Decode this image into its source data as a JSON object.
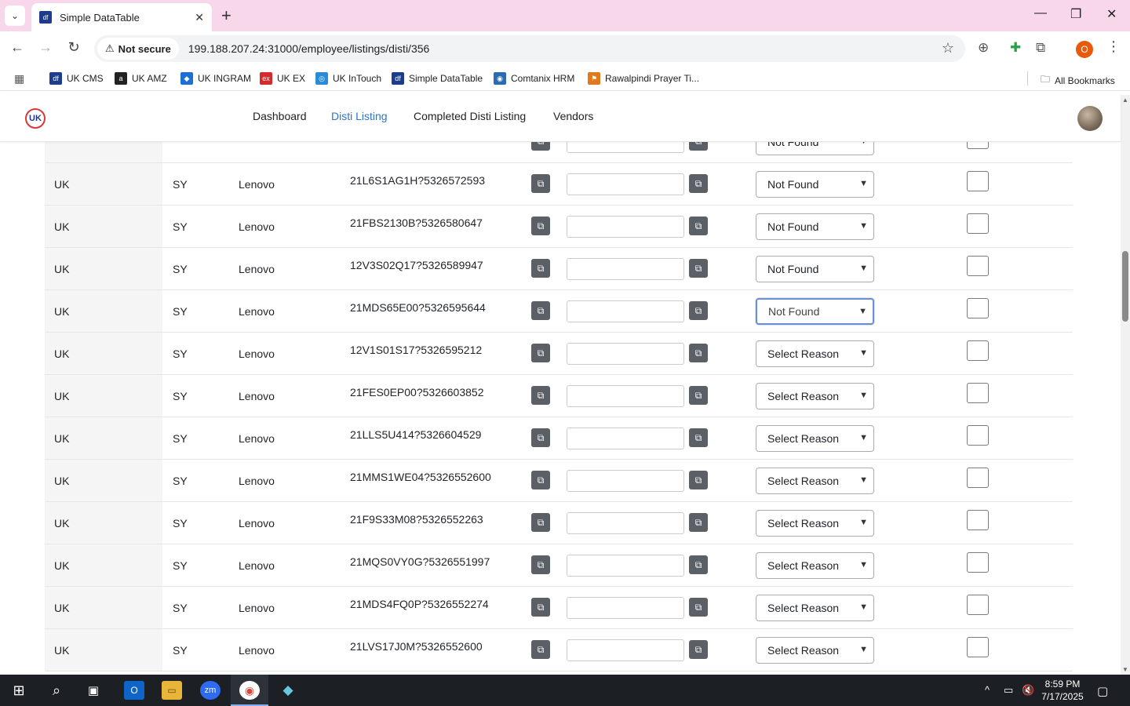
{
  "browser": {
    "tab_title": "Simple DataTable",
    "tab_favicon": "df",
    "security_label": "Not secure",
    "url": "199.188.207.24:31000/employee/listings/disti/356",
    "profile_initial": "O",
    "bookmarks": [
      {
        "label": "UK CMS",
        "icon": "df",
        "color": "#1e3c8c"
      },
      {
        "label": "UK AMZ",
        "icon": "a",
        "color": "#222222"
      },
      {
        "label": "UK INGRAM",
        "icon": "◆",
        "color": "#1d6fd1"
      },
      {
        "label": "UK EX",
        "icon": "ex",
        "color": "#d62b2b"
      },
      {
        "label": "UK InTouch",
        "icon": "◎",
        "color": "#2a8bd6"
      },
      {
        "label": "Simple DataTable",
        "icon": "df",
        "color": "#1e3c8c"
      },
      {
        "label": "Comtanix HRM",
        "icon": "◉",
        "color": "#2a6cb3"
      },
      {
        "label": "Rawalpindi Prayer Ti...",
        "icon": "⚑",
        "color": "#e07a1f"
      }
    ],
    "all_bookmarks": "All Bookmarks"
  },
  "app": {
    "logo_text": "UK",
    "nav": [
      "Dashboard",
      "Disti Listing",
      "Completed Disti Listing",
      "Vendors"
    ],
    "active_nav": "Disti Listing",
    "accent_color": "#2c76c9"
  },
  "table": {
    "partial_top_row": {
      "reason": "Not Found"
    },
    "rows": [
      {
        "country": "UK",
        "code": "SY",
        "brand": "Lenovo",
        "sku": "21L6S1AG1H?5326572593",
        "input": "",
        "reason": "Not Found",
        "focused": false
      },
      {
        "country": "UK",
        "code": "SY",
        "brand": "Lenovo",
        "sku": "21FBS2130B?5326580647",
        "input": "",
        "reason": "Not Found",
        "focused": false
      },
      {
        "country": "UK",
        "code": "SY",
        "brand": "Lenovo",
        "sku": "12V3S02Q17?5326589947",
        "input": "",
        "reason": "Not Found",
        "focused": false
      },
      {
        "country": "UK",
        "code": "SY",
        "brand": "Lenovo",
        "sku": "21MDS65E00?5326595644",
        "input": "",
        "reason": "Not Found",
        "focused": true
      },
      {
        "country": "UK",
        "code": "SY",
        "brand": "Lenovo",
        "sku": "12V1S01S17?5326595212",
        "input": "",
        "reason": "Select Reason",
        "focused": false
      },
      {
        "country": "UK",
        "code": "SY",
        "brand": "Lenovo",
        "sku": "21FES0EP00?5326603852",
        "input": "",
        "reason": "Select Reason",
        "focused": false
      },
      {
        "country": "UK",
        "code": "SY",
        "brand": "Lenovo",
        "sku": "21LLS5U414?5326604529",
        "input": "",
        "reason": "Select Reason",
        "focused": false
      },
      {
        "country": "UK",
        "code": "SY",
        "brand": "Lenovo",
        "sku": "21MMS1WE04?5326552600",
        "input": "",
        "reason": "Select Reason",
        "focused": false
      },
      {
        "country": "UK",
        "code": "SY",
        "brand": "Lenovo",
        "sku": "21F9S33M08?5326552263",
        "input": "",
        "reason": "Select Reason",
        "focused": false
      },
      {
        "country": "UK",
        "code": "SY",
        "brand": "Lenovo",
        "sku": "21MQS0VY0G?5326551997",
        "input": "",
        "reason": "Select Reason",
        "focused": false
      },
      {
        "country": "UK",
        "code": "SY",
        "brand": "Lenovo",
        "sku": "21MDS4FQ0P?5326552274",
        "input": "",
        "reason": "Select Reason",
        "focused": false
      },
      {
        "country": "UK",
        "code": "SY",
        "brand": "Lenovo",
        "sku": "21LVS17J0M?5326552600",
        "input": "",
        "reason": "Select Reason",
        "focused": false
      }
    ]
  },
  "taskbar": {
    "time": "8:59 PM",
    "date": "7/17/2025",
    "zoom_label": "zm"
  }
}
